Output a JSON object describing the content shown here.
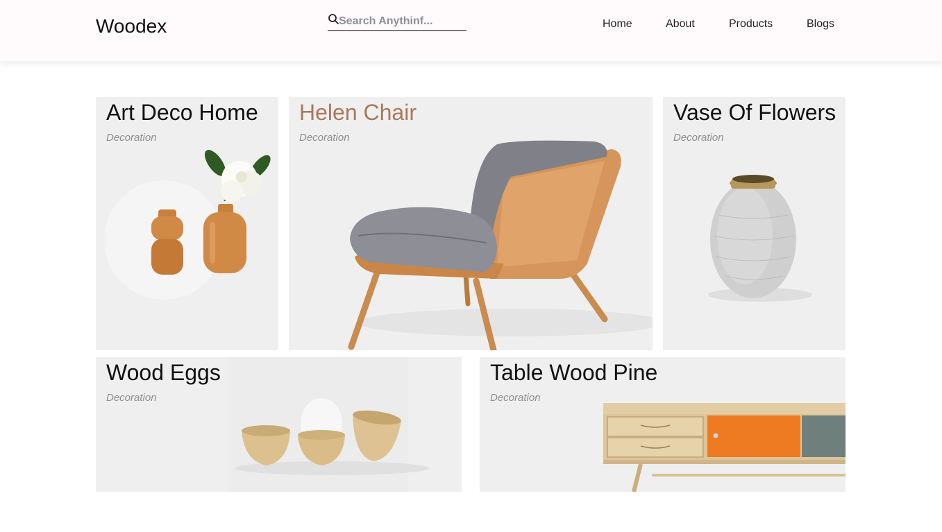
{
  "header": {
    "brand": "Woodex",
    "search_placeholder": "Search Anythinf...",
    "nav": [
      {
        "label": "Home"
      },
      {
        "label": "About"
      },
      {
        "label": "Products"
      },
      {
        "label": "Blogs"
      }
    ]
  },
  "cards": [
    {
      "title": "Art Deco Home",
      "category": "Decoration",
      "image": "wooden-vases-with-flower"
    },
    {
      "title": "Helen Chair",
      "category": "Decoration",
      "image": "lounge-chair"
    },
    {
      "title": "Vase Of Flowers",
      "category": "Decoration",
      "image": "ceramic-vase"
    },
    {
      "title": "Wood Eggs",
      "category": "Decoration",
      "image": "wooden-egg-cups"
    },
    {
      "title": "Table Wood Pine",
      "category": "Decoration",
      "image": "pine-sideboard"
    }
  ],
  "colors": {
    "accent_title": "#a9795a",
    "card_bg": "#efefef",
    "header_bg": "#fffbfc"
  }
}
